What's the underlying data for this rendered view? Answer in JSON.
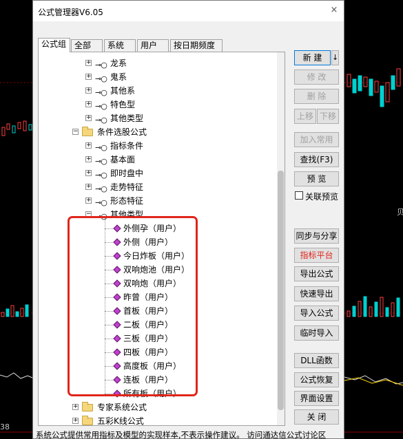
{
  "dialog": {
    "title": "公式管理器V6.05",
    "close_glyph": "×"
  },
  "tabs": [
    "公式组",
    "全部",
    "系统",
    "用户",
    "按日期频度"
  ],
  "tree": {
    "rows": [
      {
        "label": "龙系",
        "kind": "key"
      },
      {
        "label": "鬼系",
        "kind": "key"
      },
      {
        "label": "其他系",
        "kind": "key"
      },
      {
        "label": "特色型",
        "kind": "key"
      },
      {
        "label": "其他类型",
        "kind": "key"
      },
      {
        "label": "条件选股公式",
        "kind": "folder"
      },
      {
        "label": "指标条件",
        "kind": "key"
      },
      {
        "label": "基本面",
        "kind": "key"
      },
      {
        "label": "即时盘中",
        "kind": "key"
      },
      {
        "label": "走势特征",
        "kind": "key"
      },
      {
        "label": "形态特征",
        "kind": "key"
      },
      {
        "label": "其他类型",
        "kind": "key-open"
      },
      {
        "label": "外侧孕（用户）",
        "kind": "formula"
      },
      {
        "label": "外侧（用户）",
        "kind": "formula"
      },
      {
        "label": "今日炸板（用户）",
        "kind": "formula"
      },
      {
        "label": "双响炮池（用户）",
        "kind": "formula"
      },
      {
        "label": "双响炮（用户）",
        "kind": "formula"
      },
      {
        "label": "昨曾（用户）",
        "kind": "formula"
      },
      {
        "label": "首板（用户）",
        "kind": "formula"
      },
      {
        "label": "二板（用户）",
        "kind": "formula"
      },
      {
        "label": "三板（用户）",
        "kind": "formula"
      },
      {
        "label": "四板（用户）",
        "kind": "formula"
      },
      {
        "label": "高度板（用户）",
        "kind": "formula"
      },
      {
        "label": "连板（用户）",
        "kind": "formula"
      },
      {
        "label": "所有板（用户）",
        "kind": "formula"
      },
      {
        "label": "专家系统公式",
        "kind": "folder-root"
      },
      {
        "label": "五彩K线公式",
        "kind": "folder-root"
      }
    ]
  },
  "buttons": {
    "new": "新 建",
    "new_arrow": "↓",
    "edit": "修 改",
    "delete": "删 除",
    "move_up": "上移",
    "move_down": "下移",
    "add_common": "加入常用",
    "find": "查找(F3)",
    "preview": "预 览",
    "sync_share": "同步与分享",
    "indicator_platform": "指标平台",
    "export": "导出公式",
    "quick_export": "快速导出",
    "import": "导入公式",
    "temp_import": "临时导入",
    "dll": "DLL函数",
    "restore": "公式恢复",
    "ui_settings": "界面设置",
    "close": "关 闭"
  },
  "checkbox": {
    "close_preview": "关联预览"
  },
  "footer": {
    "notice": "系统公式提供常用指标及模型的实现样本,不表示操作建议。 访问通达信公式讨论区"
  },
  "background": {
    "left_number": "38",
    "right_char": "贝"
  },
  "colors": {
    "accent_red": "#e0251b",
    "formula_icon": "#c040d0",
    "folder": "#f5d67b"
  }
}
